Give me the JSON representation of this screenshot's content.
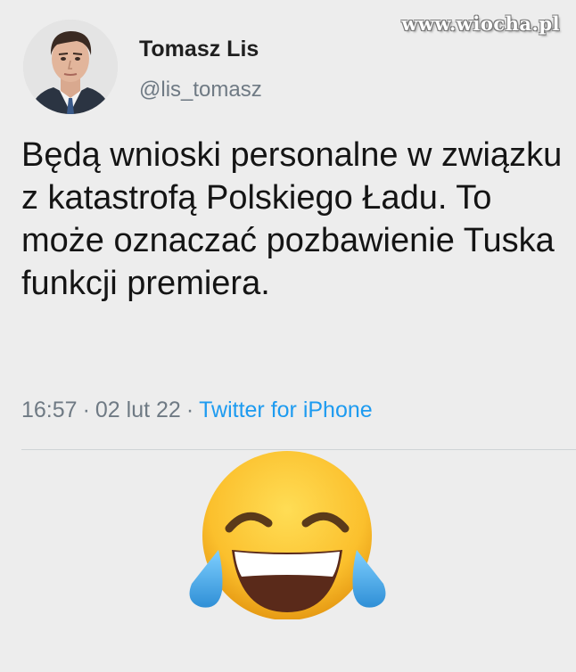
{
  "watermark": "www.wiocha.pl",
  "author": {
    "name": "Tomasz Lis",
    "handle": "@lis_tomasz"
  },
  "tweet": {
    "text": "Będą wnioski personalne w związku z katastrofą Polskiego Ładu. To może oznaczać pozbawienie Tuska funkcji premiera.",
    "time": "16:57",
    "date": "02 lut 22",
    "separator": "·",
    "source": "Twitter for iPhone"
  },
  "colors": {
    "background": "#ededed",
    "handle": "#6f7a84",
    "link": "#1d9bf0"
  },
  "icons": {
    "avatar": "profile-photo",
    "reaction": "face-with-tears-of-joy-emoji"
  }
}
